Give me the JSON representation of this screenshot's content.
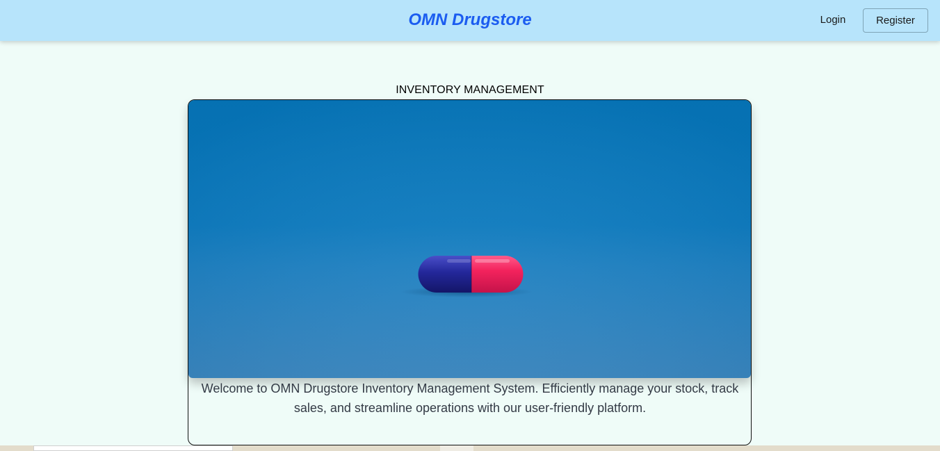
{
  "header": {
    "brand": "OMN Drugstore",
    "login_label": "Login",
    "register_label": "Register"
  },
  "main": {
    "section_title": "INVENTORY MANAGEMENT",
    "hero_image": "blue-red-capsule-photo",
    "description": "Welcome to OMN Drugstore Inventory Management System. Efficiently manage your stock, track sales, and streamline operations with our user-friendly platform."
  },
  "colors": {
    "header_bg": "#b7e4fb",
    "brand_text": "#1b5cf0",
    "page_bg": "#effcf8",
    "hero_blue": "#0a79c0",
    "capsule_blue": "#2b2f9a",
    "capsule_red": "#f0245e"
  }
}
